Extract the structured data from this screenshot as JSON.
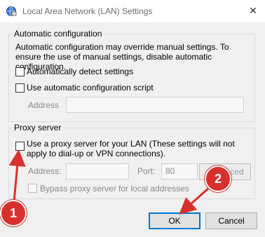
{
  "window": {
    "title": "Local Area Network (LAN) Settings",
    "close_glyph": "✕",
    "icon": "network-globe-icon"
  },
  "auto_config": {
    "group_label": "Automatic configuration",
    "description": "Automatic configuration may override manual settings.  To ensure the use of manual settings, disable automatic configuration.",
    "detect_label": "Automatically detect settings",
    "script_label": "Use automatic configuration script",
    "address_label": "Address",
    "address_value": ""
  },
  "proxy": {
    "group_label": "Proxy server",
    "use_proxy_label": "Use a proxy server for your LAN (These settings will not apply to dial-up or VPN connections).",
    "address_label": "Address:",
    "address_value": "",
    "port_label": "Port:",
    "port_value": "80",
    "advanced_label": "Advanced",
    "bypass_label": "Bypass proxy server for local addresses"
  },
  "buttons": {
    "ok": "OK",
    "cancel": "Cancel"
  },
  "annotations": {
    "callout_1": "1",
    "callout_2": "2",
    "color": "#d8302d"
  }
}
